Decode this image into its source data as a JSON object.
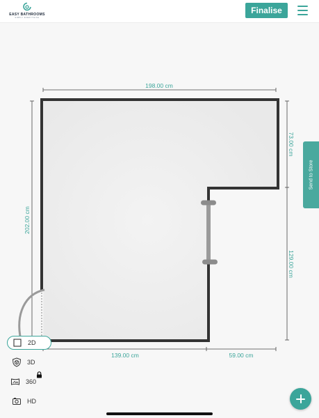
{
  "header": {
    "logo": {
      "name": "EASY BATHROOMS",
      "tagline": "SIMPLY EVERYTHING"
    },
    "finalise_label": "Finalise",
    "menu_icon": "hamburger-menu-icon"
  },
  "floorplan": {
    "dimensions": {
      "top_width": "198.00 cm",
      "left_height": "202.00 cm",
      "right_upper_height": "73.00 cm",
      "right_lower_height": "129.00 cm",
      "bottom_left_width": "139.00 cm",
      "bottom_right_width": "59.00 cm"
    },
    "fixtures": [
      "door",
      "window"
    ]
  },
  "side_tab": {
    "label": "Send to Store"
  },
  "view_modes": [
    {
      "label": "2D",
      "icon": "square-icon",
      "active": true
    },
    {
      "label": "3D",
      "icon": "shield-3d-icon",
      "active": false
    },
    {
      "label": "360",
      "icon": "panorama-icon",
      "active": false,
      "locked": true
    },
    {
      "label": "HD",
      "icon": "camera-icon",
      "active": false
    }
  ],
  "fab_icon": "plus-icon",
  "colors": {
    "accent": "#3ba59a",
    "wall": "#333333",
    "floor": "#ececec",
    "background": "#f7f7f7"
  }
}
